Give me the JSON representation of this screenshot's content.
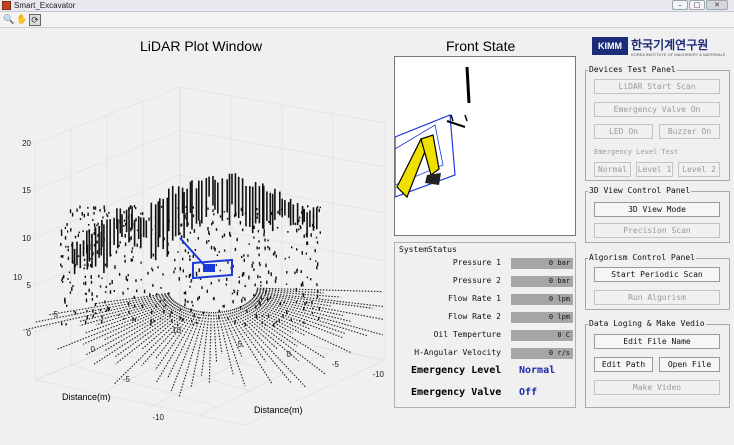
{
  "window": {
    "title": "Smart_Excavator",
    "min": "–",
    "max": "□",
    "close": "✕"
  },
  "toolbar": {
    "zoom": "🔍",
    "pan": "✋",
    "rotate": "⟳"
  },
  "lidar": {
    "title": "LiDAR Plot Window",
    "z_ticks": [
      "20",
      "15",
      "10",
      "5",
      "0"
    ],
    "left_ticks": [
      "10",
      "5",
      "0",
      "-5",
      "-10"
    ],
    "bottom_ticks": [
      "10",
      "5",
      "0",
      "-5",
      "-10"
    ],
    "xlabel": "Distance(m)",
    "ylabel": "Distance(m)"
  },
  "front": {
    "title": "Front State"
  },
  "status": {
    "title": "SystemStatus",
    "rows": [
      {
        "label": "Pressure 1",
        "value": "0 bar"
      },
      {
        "label": "Pressure 2",
        "value": "0 bar"
      },
      {
        "label": "Flow Rate 1",
        "value": "0 lpm"
      },
      {
        "label": "Flow Rate 2",
        "value": "0 lpm"
      },
      {
        "label": "Oil Temperture",
        "value": "0 C"
      },
      {
        "label": "H-Angular Velocity",
        "value": "0 r/s"
      }
    ],
    "emergency_level_label": "Emergency Level",
    "emergency_level_value": "Normal",
    "emergency_valve_label": "Emergency Valve",
    "emergency_valve_value": "Off"
  },
  "logo": {
    "badge": "KIMM",
    "name": "한국기계연구원",
    "sub": "KOREA INSTITUTE OF MACHINERY & MATERIALS"
  },
  "devices": {
    "title": "Devices Test Panel",
    "lidar_start": "LiDAR Start Scan",
    "emergency_valve_on": "Emergency Valve On",
    "led_on": "LED On",
    "buzzer_on": "Buzzer On",
    "level_test_label": "Emergency Level Test",
    "normal": "Normal",
    "level1": "Level 1",
    "level2": "Level 2"
  },
  "view3d": {
    "title": "3D View Control Panel",
    "mode": "3D View Mode",
    "precision": "Precision Scan"
  },
  "algo": {
    "title": "Algorism Control Panel",
    "periodic": "Start Periodic Scan",
    "run": "Run Algorism"
  },
  "datalog": {
    "title": "Data Loging & Make Vedio",
    "edit_name": "Edit File Name",
    "edit_path": "Edit Path",
    "open_file": "Open File",
    "make_video": "Make Video"
  }
}
